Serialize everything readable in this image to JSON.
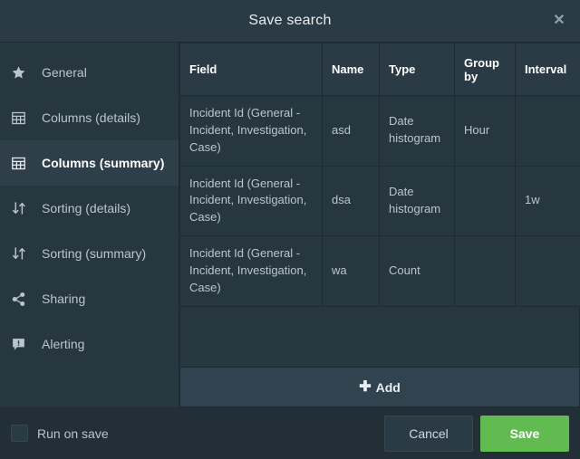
{
  "header": {
    "title": "Save search",
    "close_label": "✕"
  },
  "sidebar": {
    "items": [
      {
        "label": "General",
        "icon": "star-icon",
        "active": false
      },
      {
        "label": "Columns (details)",
        "icon": "table-grid-icon",
        "active": false
      },
      {
        "label": "Columns (summary)",
        "icon": "table-grid-icon",
        "active": true
      },
      {
        "label": "Sorting (details)",
        "icon": "sort-arrows-icon",
        "active": false
      },
      {
        "label": "Sorting (summary)",
        "icon": "sort-arrows-icon",
        "active": false
      },
      {
        "label": "Sharing",
        "icon": "share-nodes-icon",
        "active": false
      },
      {
        "label": "Alerting",
        "icon": "alert-bubble-icon",
        "active": false
      }
    ]
  },
  "table": {
    "columns": [
      "Field",
      "Name",
      "Type",
      "Group by",
      "Interval"
    ],
    "rows": [
      {
        "field": "Incident Id (General - Incident, Investigation, Case)",
        "name": "asd",
        "type": "Date histogram",
        "group_by": "Hour",
        "interval": ""
      },
      {
        "field": "Incident Id (General - Incident, Investigation, Case)",
        "name": "dsa",
        "type": "Date histogram",
        "group_by": "",
        "interval": "1w"
      },
      {
        "field": "Incident Id (General - Incident, Investigation, Case)",
        "name": "wa",
        "type": "Count",
        "group_by": "",
        "interval": ""
      }
    ],
    "add_label": "Add",
    "add_icon": "plus-icon"
  },
  "footer": {
    "run_on_save_label": "Run on save",
    "run_on_save_checked": false,
    "cancel_label": "Cancel",
    "save_label": "Save"
  },
  "colors": {
    "modal_bg": "#273740",
    "header_bg": "#2b3b45",
    "footer_bg": "#232f36",
    "active_item_bg": "#2e3f49",
    "border": "#1f2b32",
    "save_green": "#62bb51",
    "text": "#b9c6cd",
    "text_bright": "#ffffff"
  }
}
